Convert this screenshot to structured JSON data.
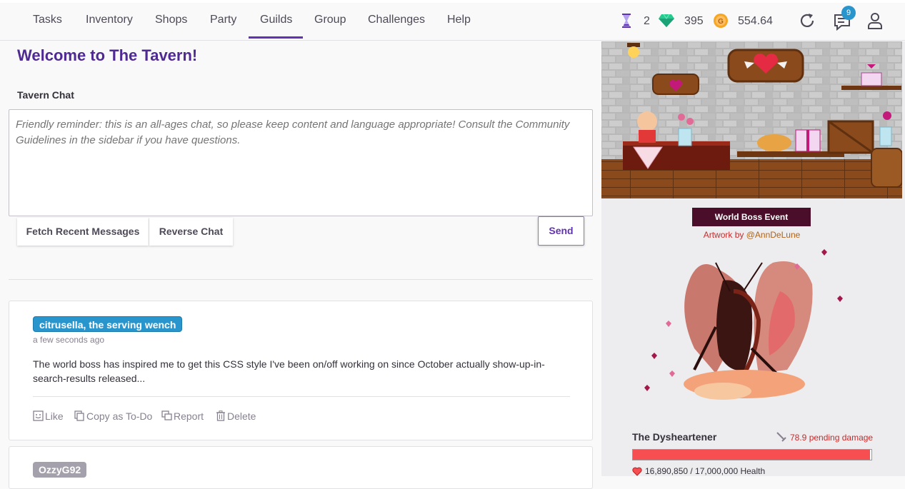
{
  "nav": {
    "items": [
      {
        "label": "Tasks",
        "active": false
      },
      {
        "label": "Inventory",
        "active": false
      },
      {
        "label": "Shops",
        "active": false
      },
      {
        "label": "Party",
        "active": false
      },
      {
        "label": "Guilds",
        "active": true
      },
      {
        "label": "Group",
        "active": false
      },
      {
        "label": "Challenges",
        "active": false
      },
      {
        "label": "Help",
        "active": false
      }
    ],
    "hourglasses": "2",
    "gems": "395",
    "gold": "554.64",
    "notification_count": "9",
    "icons": [
      "hourglass-icon",
      "gem-icon",
      "gold-coin-icon",
      "sync-icon",
      "notifications-icon",
      "user-icon"
    ]
  },
  "page": {
    "title": "Welcome to The Tavern!",
    "chat_label": "Tavern Chat",
    "chat_placeholder": "Friendly reminder: this is an all-ages chat, so please keep content and language appropriate! Consult the Community Guidelines in the sidebar if you have questions.",
    "fetch_label": "Fetch Recent Messages",
    "reverse_label": "Reverse Chat",
    "send_label": "Send"
  },
  "messages": [
    {
      "user": "citrusella, the serving wench",
      "time": "a few seconds ago",
      "text": "The world boss has inspired me to get this CSS style I've been on/off working on since October actually show-up-in-search-results released...",
      "actions": {
        "like": "Like",
        "copy": "Copy as To-Do",
        "report": "Report",
        "delete": "Delete"
      }
    },
    {
      "user": "OzzyG92"
    }
  ],
  "sidebar": {
    "event_label": "World Boss Event",
    "artwork_prefix": "Artwork by ",
    "artist": "@AnnDeLune",
    "boss_name": "The Dysheartener",
    "pending_damage": "78.9 pending damage",
    "health_text": "16,890,850 / 17,000,000 Health",
    "health_current": 16890850,
    "health_max": 17000000,
    "colors": {
      "health": "#f74e52",
      "event_bg": "#4a0e2a",
      "accent": "#6133b4"
    }
  }
}
